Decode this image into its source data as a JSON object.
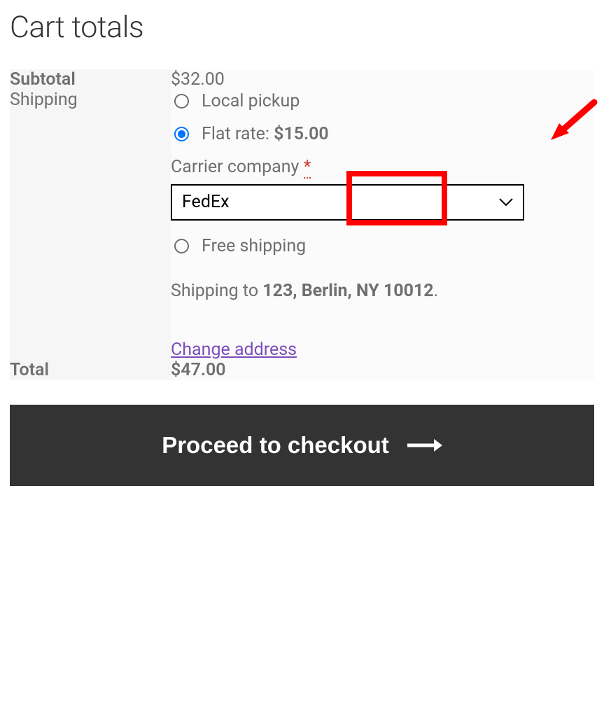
{
  "title": "Cart totals",
  "subtotal": {
    "label": "Subtotal",
    "value": "$32.00"
  },
  "shipping": {
    "label": "Shipping",
    "options": [
      {
        "label": "Local pickup",
        "checked": false
      },
      {
        "label": "Flat rate:",
        "price": "$15.00",
        "checked": true
      },
      {
        "label": "Free shipping",
        "checked": false
      }
    ],
    "carrier": {
      "label": "Carrier company",
      "required_marker": "*",
      "selected": "FedEx"
    },
    "ship_to_prefix": "Shipping to ",
    "ship_to_address": "123, Berlin, NY 10012",
    "ship_to_suffix": ".",
    "change_address": "Change address"
  },
  "total": {
    "label": "Total",
    "value": "$47.00"
  },
  "checkout_label": "Proceed to checkout"
}
